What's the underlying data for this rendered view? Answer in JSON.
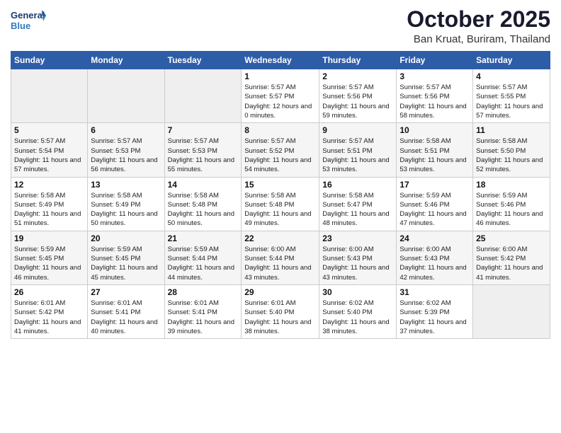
{
  "logo": {
    "line1": "General",
    "line2": "Blue"
  },
  "title": "October 2025",
  "location": "Ban Kruat, Buriram, Thailand",
  "weekdays": [
    "Sunday",
    "Monday",
    "Tuesday",
    "Wednesday",
    "Thursday",
    "Friday",
    "Saturday"
  ],
  "weeks": [
    [
      {
        "day": "",
        "sunrise": "",
        "sunset": "",
        "daylight": ""
      },
      {
        "day": "",
        "sunrise": "",
        "sunset": "",
        "daylight": ""
      },
      {
        "day": "",
        "sunrise": "",
        "sunset": "",
        "daylight": ""
      },
      {
        "day": "1",
        "sunrise": "Sunrise: 5:57 AM",
        "sunset": "Sunset: 5:57 PM",
        "daylight": "Daylight: 12 hours and 0 minutes."
      },
      {
        "day": "2",
        "sunrise": "Sunrise: 5:57 AM",
        "sunset": "Sunset: 5:56 PM",
        "daylight": "Daylight: 11 hours and 59 minutes."
      },
      {
        "day": "3",
        "sunrise": "Sunrise: 5:57 AM",
        "sunset": "Sunset: 5:56 PM",
        "daylight": "Daylight: 11 hours and 58 minutes."
      },
      {
        "day": "4",
        "sunrise": "Sunrise: 5:57 AM",
        "sunset": "Sunset: 5:55 PM",
        "daylight": "Daylight: 11 hours and 57 minutes."
      }
    ],
    [
      {
        "day": "5",
        "sunrise": "Sunrise: 5:57 AM",
        "sunset": "Sunset: 5:54 PM",
        "daylight": "Daylight: 11 hours and 57 minutes."
      },
      {
        "day": "6",
        "sunrise": "Sunrise: 5:57 AM",
        "sunset": "Sunset: 5:53 PM",
        "daylight": "Daylight: 11 hours and 56 minutes."
      },
      {
        "day": "7",
        "sunrise": "Sunrise: 5:57 AM",
        "sunset": "Sunset: 5:53 PM",
        "daylight": "Daylight: 11 hours and 55 minutes."
      },
      {
        "day": "8",
        "sunrise": "Sunrise: 5:57 AM",
        "sunset": "Sunset: 5:52 PM",
        "daylight": "Daylight: 11 hours and 54 minutes."
      },
      {
        "day": "9",
        "sunrise": "Sunrise: 5:57 AM",
        "sunset": "Sunset: 5:51 PM",
        "daylight": "Daylight: 11 hours and 53 minutes."
      },
      {
        "day": "10",
        "sunrise": "Sunrise: 5:58 AM",
        "sunset": "Sunset: 5:51 PM",
        "daylight": "Daylight: 11 hours and 53 minutes."
      },
      {
        "day": "11",
        "sunrise": "Sunrise: 5:58 AM",
        "sunset": "Sunset: 5:50 PM",
        "daylight": "Daylight: 11 hours and 52 minutes."
      }
    ],
    [
      {
        "day": "12",
        "sunrise": "Sunrise: 5:58 AM",
        "sunset": "Sunset: 5:49 PM",
        "daylight": "Daylight: 11 hours and 51 minutes."
      },
      {
        "day": "13",
        "sunrise": "Sunrise: 5:58 AM",
        "sunset": "Sunset: 5:49 PM",
        "daylight": "Daylight: 11 hours and 50 minutes."
      },
      {
        "day": "14",
        "sunrise": "Sunrise: 5:58 AM",
        "sunset": "Sunset: 5:48 PM",
        "daylight": "Daylight: 11 hours and 50 minutes."
      },
      {
        "day": "15",
        "sunrise": "Sunrise: 5:58 AM",
        "sunset": "Sunset: 5:48 PM",
        "daylight": "Daylight: 11 hours and 49 minutes."
      },
      {
        "day": "16",
        "sunrise": "Sunrise: 5:58 AM",
        "sunset": "Sunset: 5:47 PM",
        "daylight": "Daylight: 11 hours and 48 minutes."
      },
      {
        "day": "17",
        "sunrise": "Sunrise: 5:59 AM",
        "sunset": "Sunset: 5:46 PM",
        "daylight": "Daylight: 11 hours and 47 minutes."
      },
      {
        "day": "18",
        "sunrise": "Sunrise: 5:59 AM",
        "sunset": "Sunset: 5:46 PM",
        "daylight": "Daylight: 11 hours and 46 minutes."
      }
    ],
    [
      {
        "day": "19",
        "sunrise": "Sunrise: 5:59 AM",
        "sunset": "Sunset: 5:45 PM",
        "daylight": "Daylight: 11 hours and 46 minutes."
      },
      {
        "day": "20",
        "sunrise": "Sunrise: 5:59 AM",
        "sunset": "Sunset: 5:45 PM",
        "daylight": "Daylight: 11 hours and 45 minutes."
      },
      {
        "day": "21",
        "sunrise": "Sunrise: 5:59 AM",
        "sunset": "Sunset: 5:44 PM",
        "daylight": "Daylight: 11 hours and 44 minutes."
      },
      {
        "day": "22",
        "sunrise": "Sunrise: 6:00 AM",
        "sunset": "Sunset: 5:44 PM",
        "daylight": "Daylight: 11 hours and 43 minutes."
      },
      {
        "day": "23",
        "sunrise": "Sunrise: 6:00 AM",
        "sunset": "Sunset: 5:43 PM",
        "daylight": "Daylight: 11 hours and 43 minutes."
      },
      {
        "day": "24",
        "sunrise": "Sunrise: 6:00 AM",
        "sunset": "Sunset: 5:43 PM",
        "daylight": "Daylight: 11 hours and 42 minutes."
      },
      {
        "day": "25",
        "sunrise": "Sunrise: 6:00 AM",
        "sunset": "Sunset: 5:42 PM",
        "daylight": "Daylight: 11 hours and 41 minutes."
      }
    ],
    [
      {
        "day": "26",
        "sunrise": "Sunrise: 6:01 AM",
        "sunset": "Sunset: 5:42 PM",
        "daylight": "Daylight: 11 hours and 41 minutes."
      },
      {
        "day": "27",
        "sunrise": "Sunrise: 6:01 AM",
        "sunset": "Sunset: 5:41 PM",
        "daylight": "Daylight: 11 hours and 40 minutes."
      },
      {
        "day": "28",
        "sunrise": "Sunrise: 6:01 AM",
        "sunset": "Sunset: 5:41 PM",
        "daylight": "Daylight: 11 hours and 39 minutes."
      },
      {
        "day": "29",
        "sunrise": "Sunrise: 6:01 AM",
        "sunset": "Sunset: 5:40 PM",
        "daylight": "Daylight: 11 hours and 38 minutes."
      },
      {
        "day": "30",
        "sunrise": "Sunrise: 6:02 AM",
        "sunset": "Sunset: 5:40 PM",
        "daylight": "Daylight: 11 hours and 38 minutes."
      },
      {
        "day": "31",
        "sunrise": "Sunrise: 6:02 AM",
        "sunset": "Sunset: 5:39 PM",
        "daylight": "Daylight: 11 hours and 37 minutes."
      },
      {
        "day": "",
        "sunrise": "",
        "sunset": "",
        "daylight": ""
      }
    ]
  ]
}
